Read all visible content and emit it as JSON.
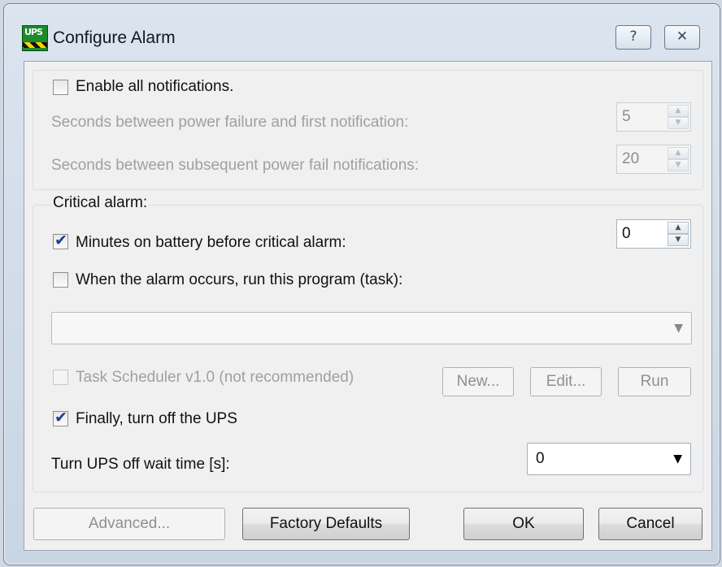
{
  "window": {
    "title": "Configure Alarm",
    "icon_text": "UPS",
    "help_glyph": "?",
    "close_glyph": "✕"
  },
  "notifications": {
    "enable_label": "Enable all notifications.",
    "enable_checked": false,
    "first_delay_label": "Seconds between power failure and first notification:",
    "first_delay_value": "5",
    "subsequent_label": "Seconds between subsequent power fail notifications:",
    "subsequent_value": "20"
  },
  "critical": {
    "group_label": "Critical alarm:",
    "minutes_label": "Minutes on battery before critical alarm:",
    "minutes_checked": true,
    "minutes_value": "0",
    "run_program_label": "When the alarm occurs, run this program (task):",
    "run_program_checked": false,
    "program_value": "",
    "task_scheduler_label": "Task Scheduler v1.0 (not recommended)",
    "task_scheduler_checked": false,
    "new_label": "New...",
    "edit_label": "Edit...",
    "run_label": "Run",
    "turn_off_label": "Finally, turn off the UPS",
    "turn_off_checked": true,
    "wait_time_label": "Turn UPS off wait time [s]:",
    "wait_time_value": "0"
  },
  "footer": {
    "advanced_label": "Advanced...",
    "factory_defaults_label": "Factory Defaults",
    "ok_label": "OK",
    "cancel_label": "Cancel"
  },
  "icons": {
    "check": "✔",
    "spin_up": "▲",
    "spin_down": "▼",
    "dropdown": "▼"
  }
}
